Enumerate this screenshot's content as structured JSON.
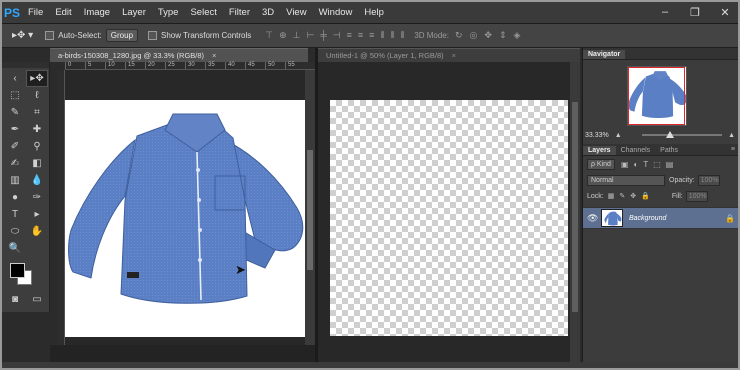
{
  "app": {
    "logo": "PS"
  },
  "menu": [
    "File",
    "Edit",
    "Image",
    "Layer",
    "Type",
    "Select",
    "Filter",
    "3D",
    "View",
    "Window",
    "Help"
  ],
  "window_controls": {
    "minimize": "–",
    "restore": "❐",
    "close": "✕"
  },
  "options_bar": {
    "auto_select_label": "Auto-Select:",
    "auto_select_value": "Group",
    "transform_label": "Show Transform Controls",
    "mode_3d_label": "3D Mode:"
  },
  "documents": [
    {
      "tab_label": "a-birds-150308_1280.jpg @ 33.3% (RGB/8)",
      "close": "×",
      "ruler_ticks": [
        "0",
        "5",
        "10",
        "15",
        "20",
        "25",
        "30",
        "35",
        "40",
        "45",
        "50",
        "55"
      ]
    },
    {
      "tab_label": "Untitled-1 @ 50% (Layer 1, RGB/8)",
      "close": "×"
    }
  ],
  "navigator": {
    "tab_label": "Navigator",
    "zoom_value": "33.33%",
    "zoom_level": 0.3333
  },
  "layers_panel": {
    "tabs": [
      "Layers",
      "Channels",
      "Paths"
    ],
    "kind_label": "ρ Kind",
    "blend_mode": "Normal",
    "opacity_label": "Opacity:",
    "opacity_value": "100%",
    "lock_label": "Lock:",
    "fill_label": "Fill:",
    "fill_value": "100%",
    "layer_name": "Background"
  },
  "colors": {
    "shirt": "#5a7fc4",
    "layer_selected": "#5d7092",
    "nav_view_box": "#e0282a",
    "foreground": "#000000",
    "background": "#ffffff"
  }
}
